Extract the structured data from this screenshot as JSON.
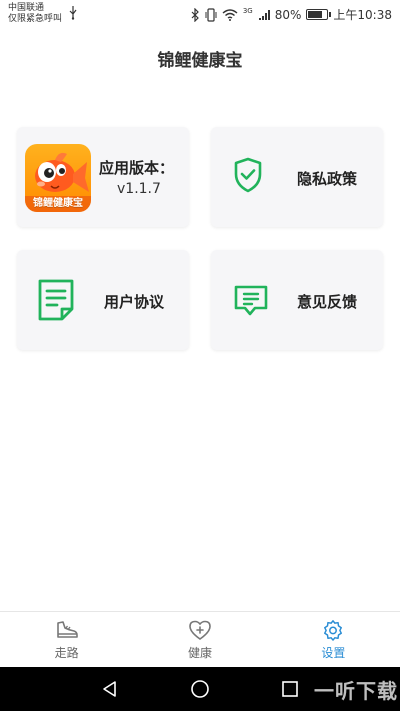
{
  "status_bar": {
    "carrier_line1": "中国联通",
    "carrier_line2": "仅限紧急呼叫",
    "network": "3G",
    "battery_text": "80%",
    "battery_level": 0.8,
    "time": "上午10:38"
  },
  "app": {
    "title": "锦鲤健康宝"
  },
  "cards": {
    "version": {
      "logo_text": "锦鲤健康宝",
      "label": "应用版本：",
      "value": "v1.1.7"
    },
    "privacy": {
      "label": "隐私政策",
      "icon": "shield-check-icon"
    },
    "agreement": {
      "label": "用户协议",
      "icon": "document-icon"
    },
    "feedback": {
      "label": "意见反馈",
      "icon": "chat-bubble-icon"
    }
  },
  "accent_color": "#21b35b",
  "tabs": [
    {
      "label": "走路",
      "icon": "shoe-icon",
      "active": false
    },
    {
      "label": "健康",
      "icon": "heart-plus-icon",
      "active": false
    },
    {
      "label": "设置",
      "icon": "gear-icon",
      "active": true
    }
  ],
  "active_tab_color": "#2a8dd4",
  "watermark": "一听下载"
}
